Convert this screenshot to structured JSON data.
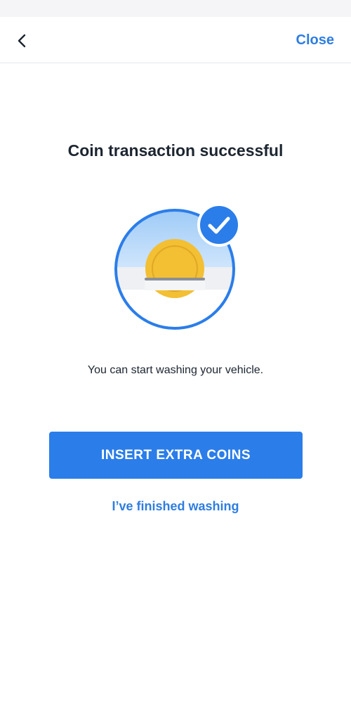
{
  "header": {
    "back_icon": "chevron-left-icon",
    "close_label": "Close"
  },
  "main": {
    "title": "Coin transaction successful",
    "illustration": {
      "coin_icon": "coin-slot-icon",
      "check_icon": "checkmark-badge-icon"
    },
    "message": "You can start washing your vehicle.",
    "primary_button_label": "INSERT EXTRA COINS",
    "secondary_link_label": "I’ve finished washing"
  },
  "colors": {
    "accent": "#2b7de9",
    "link": "#2e7de1",
    "text_primary": "#1c2530",
    "coin": "#f3bf33",
    "sky": "#bfdcfb"
  }
}
